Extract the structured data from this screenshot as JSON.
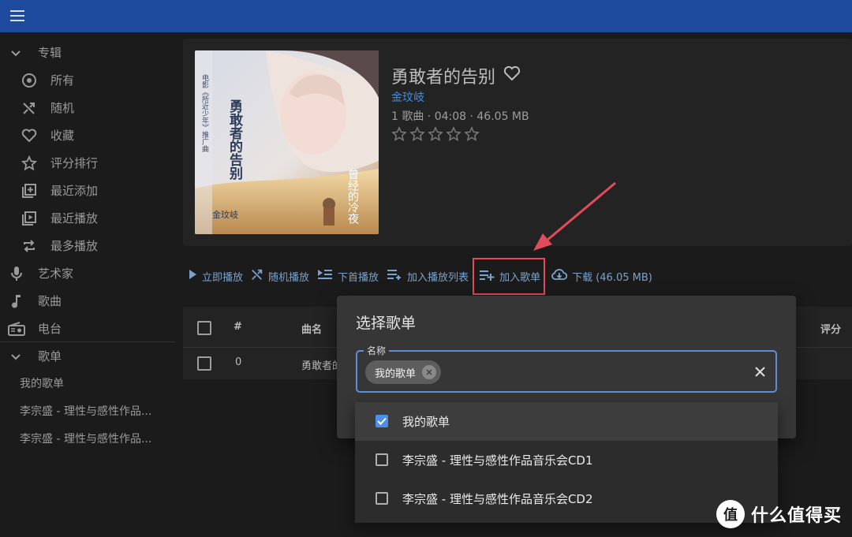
{
  "colors": {
    "appbar": "#1e4a9e",
    "accent": "#3b8de6",
    "highlight": "#e34b5c"
  },
  "sidebar": {
    "sections": [
      {
        "label": "专辑",
        "icon": "chevron-down-icon"
      },
      {
        "label": "所有",
        "icon": "album-icon"
      },
      {
        "label": "随机",
        "icon": "shuffle-icon"
      },
      {
        "label": "收藏",
        "icon": "heart-icon"
      },
      {
        "label": "评分排行",
        "icon": "star-icon"
      },
      {
        "label": "最近添加",
        "icon": "library-add-icon"
      },
      {
        "label": "最近播放",
        "icon": "library-play-icon"
      },
      {
        "label": "最多播放",
        "icon": "repeat-icon"
      },
      {
        "label": "艺术家",
        "icon": "mic-icon"
      },
      {
        "label": "歌曲",
        "icon": "music-note-icon"
      },
      {
        "label": "电台",
        "icon": "radio-icon"
      },
      {
        "label": "歌单",
        "icon": "chevron-down-icon"
      }
    ],
    "playlists": [
      "我的歌单",
      "李宗盛 - 理性与感性作品...",
      "李宗盛 - 理性与感性作品..."
    ]
  },
  "album": {
    "title": "勇敢者的告别",
    "artist": "金玟岐",
    "meta": "1 歌曲 · 04:08 · 46.05 MB",
    "rating": 0,
    "cover_text": "勇敢者的告别",
    "cover_side_text": "电影《所近少年》推广曲",
    "cover_artist": "金玟岐",
    "cover_art_title": "曾经的冷夜"
  },
  "actions": {
    "play_now": "立即播放",
    "shuffle": "随机播放",
    "play_next": "下首播放",
    "add_queue": "加入播放列表",
    "add_playlist": "加入歌单",
    "download": "下载 (46.05 MB)"
  },
  "table": {
    "headers": {
      "num": "#",
      "title": "曲名",
      "rating": "评分"
    },
    "rows": [
      {
        "num": "0",
        "title": "勇敢者的"
      }
    ]
  },
  "dialog": {
    "title": "选择歌单",
    "field_label": "名称",
    "chip": "我的歌单",
    "options": [
      {
        "label": "我的歌单",
        "checked": true
      },
      {
        "label": "李宗盛 - 理性与感性作品音乐会CD1",
        "checked": false
      },
      {
        "label": "李宗盛 - 理性与感性作品音乐会CD2",
        "checked": false
      }
    ]
  },
  "watermark": {
    "text": "什么值得买",
    "logo": "值"
  }
}
